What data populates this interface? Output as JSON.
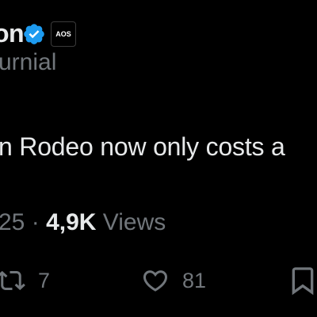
{
  "author": {
    "name_visible": "on",
    "handle_visible": "urnial",
    "affiliate_badge": "AOS"
  },
  "tweet": {
    "text_visible": "n Rodeo now only costs a"
  },
  "meta": {
    "date_visible": "25",
    "separator": "·",
    "views_count": "4,9K",
    "views_label": "Views"
  },
  "actions": {
    "retweets": "7",
    "likes": "81"
  },
  "icons": {
    "verified": "verified-badge-icon",
    "retweet": "retweet-icon",
    "like": "heart-icon",
    "bookmark": "bookmark-icon"
  },
  "colors": {
    "background": "#000000",
    "primary_text": "#e7e9ea",
    "secondary_text": "#71767b",
    "verified_blue": "#1d9bf0"
  }
}
